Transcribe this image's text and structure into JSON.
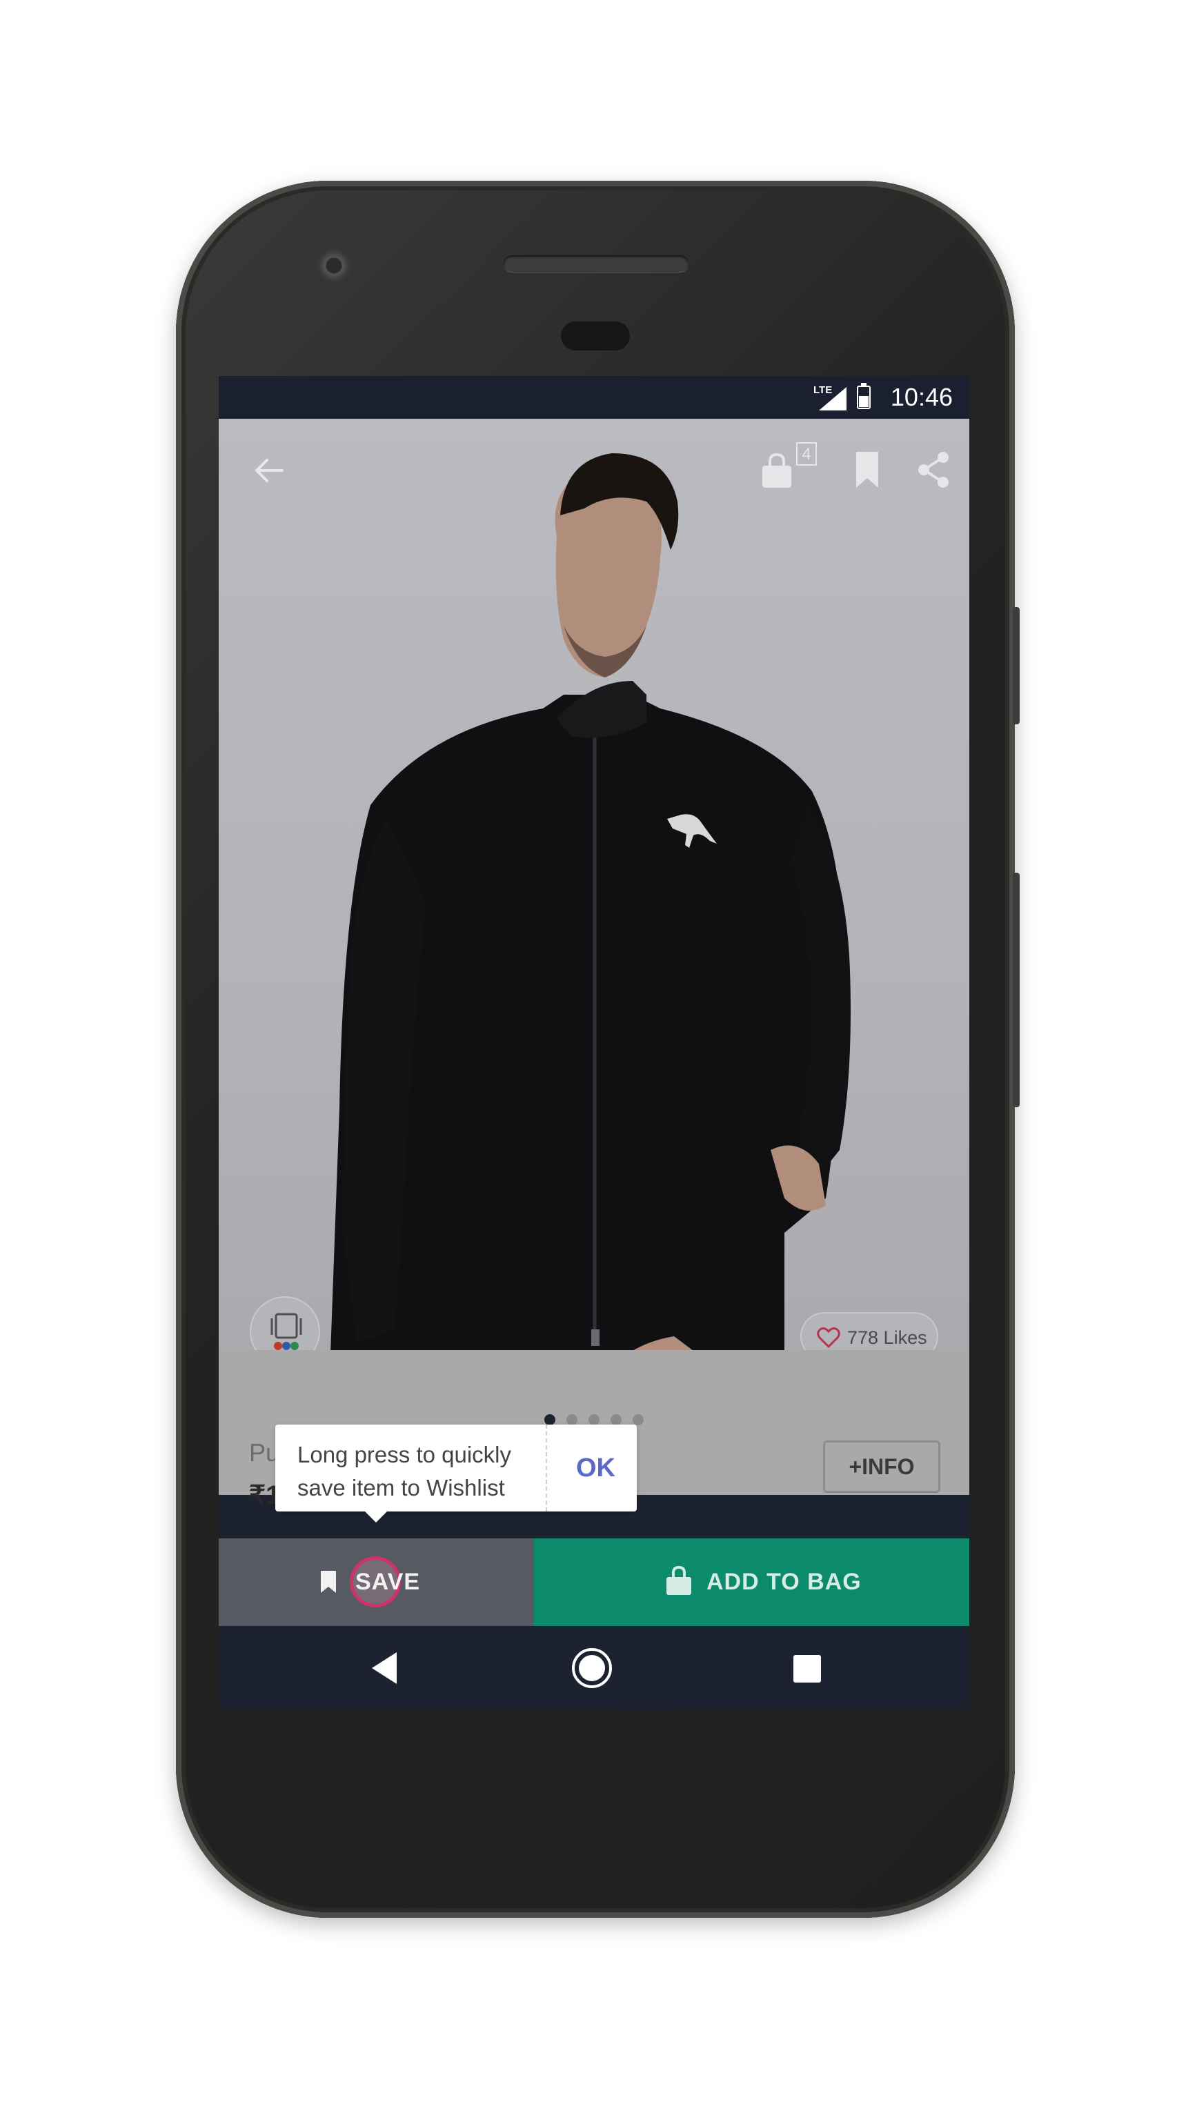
{
  "status_bar": {
    "time": "10:46",
    "network": "LTE"
  },
  "header": {
    "bag_count": "4"
  },
  "product": {
    "likes": "778 Likes",
    "brand_partial": "Pu",
    "price_partial": "₹1",
    "info_label": "+INFO",
    "carousel_total": 5,
    "carousel_active": 0
  },
  "tooltip": {
    "message": "Long press to quickly save item to Wishlist",
    "ok_label": "OK"
  },
  "actions": {
    "save_label": "SAVE",
    "add_to_bag_label": "ADD TO BAG"
  },
  "colors": {
    "save_bg": "#575a63",
    "add_bg": "#0b8a6c",
    "ok_text": "#5a68c8",
    "ripple": "#cc3366"
  }
}
